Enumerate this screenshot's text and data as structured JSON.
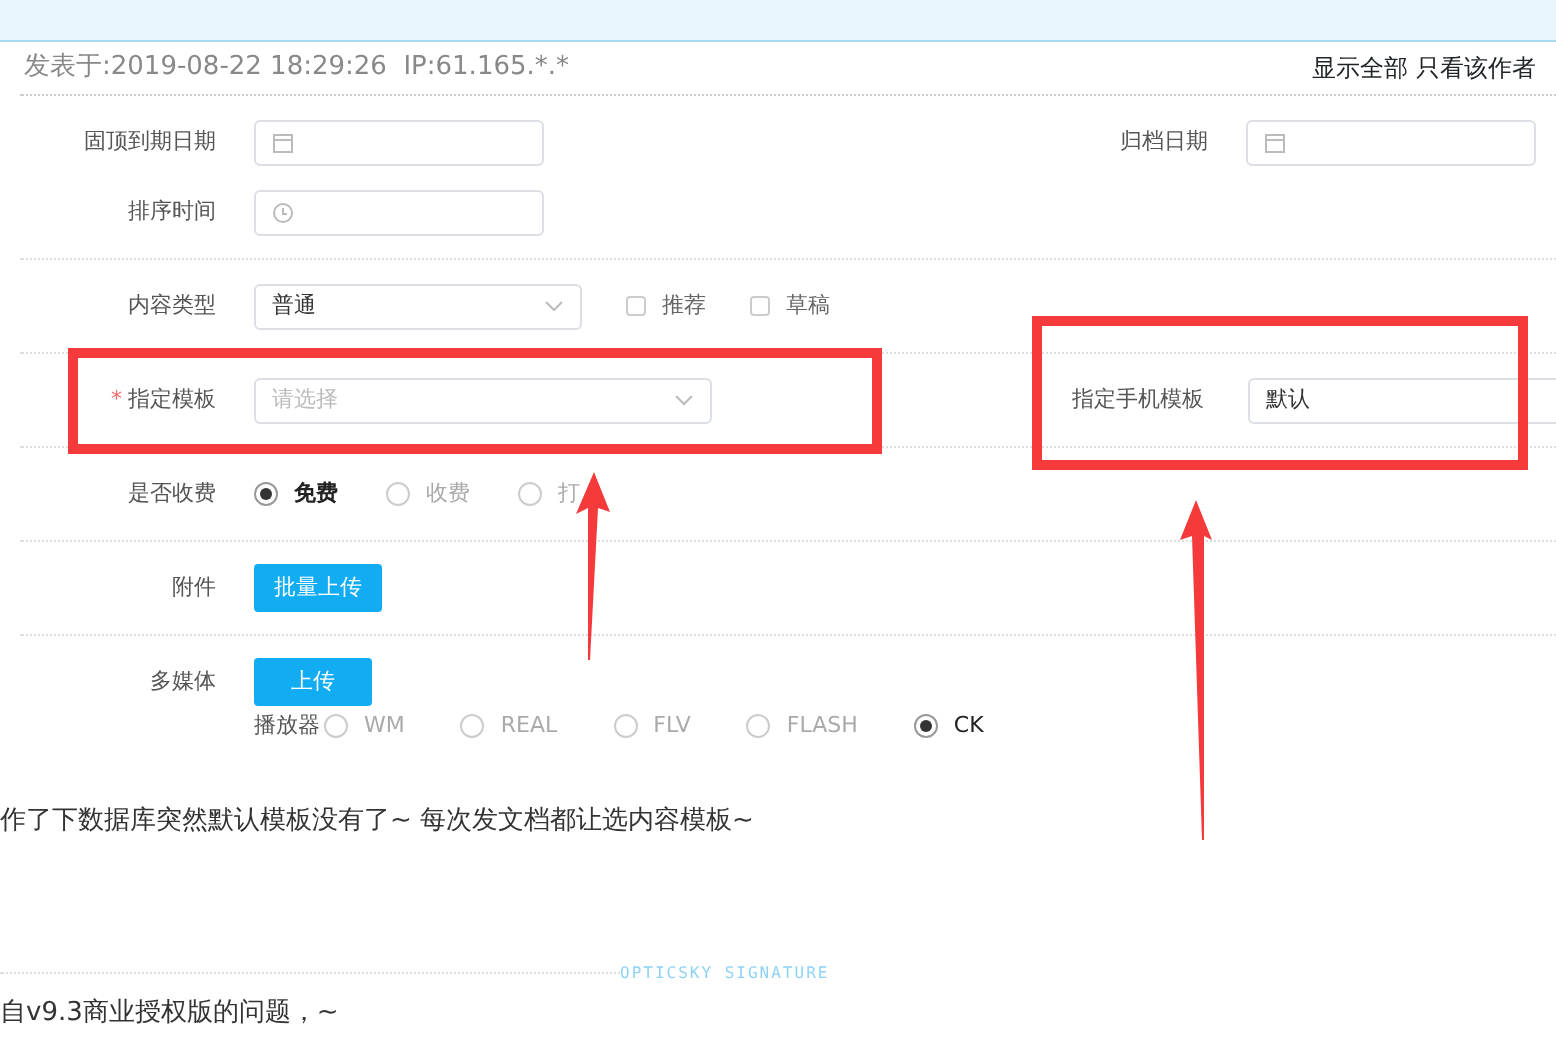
{
  "post_header": {
    "meta": "发表于:2019-08-22 18:29:26  IP:61.165.*.*",
    "links": [
      "显示全部",
      "只看该作者"
    ]
  },
  "form": {
    "pin_expiry": {
      "label": "固顶到期日期"
    },
    "archive_date": {
      "label": "归档日期"
    },
    "sort_time": {
      "label": "排序时间"
    },
    "content_type": {
      "label": "内容类型",
      "value": "普通"
    },
    "flags": [
      {
        "label": "推荐",
        "checked": false
      },
      {
        "label": "草稿",
        "checked": false
      }
    ],
    "template": {
      "label": "指定模板",
      "required_mark": "*",
      "placeholder": "请选择"
    },
    "mobile_template": {
      "label": "指定手机模板",
      "value": "默认"
    },
    "charge": {
      "label": "是否收费",
      "options": [
        {
          "label": "免费",
          "selected": true
        },
        {
          "label": "收费",
          "selected": false
        },
        {
          "label": "打",
          "selected": false
        }
      ]
    },
    "attachment": {
      "label": "附件",
      "button": "批量上传"
    },
    "media": {
      "label": "多媒体",
      "button": "上传",
      "player_label": "播放器",
      "players": [
        {
          "label": "WM",
          "selected": false
        },
        {
          "label": "REAL",
          "selected": false
        },
        {
          "label": "FLV",
          "selected": false
        },
        {
          "label": "FLASH",
          "selected": false
        },
        {
          "label": "CK",
          "selected": true
        }
      ]
    }
  },
  "post_text": "作了下数据库突然默认模板没有了~ 每次发文档都让选内容模板~",
  "signature": {
    "label": "OPTICSKY SIGNATURE",
    "text": "自v9.3商业授权版的问题，~"
  }
}
